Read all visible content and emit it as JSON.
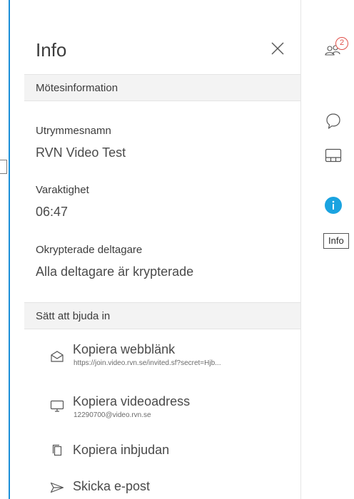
{
  "panel": {
    "title": "Info",
    "close_icon": "close-icon"
  },
  "meeting_info": {
    "section_title": "Mötesinformation",
    "fields": [
      {
        "label": "Utrymmesnamn",
        "value": "RVN Video Test"
      },
      {
        "label": "Varaktighet",
        "value": "06:47"
      },
      {
        "label": "Okrypterade deltagare",
        "value": "Alla deltagare är krypterade"
      }
    ]
  },
  "invite": {
    "section_title": "Sätt att bjuda in",
    "items": [
      {
        "icon": "envelope-open-icon",
        "title": "Kopiera webblänk",
        "subtitle": "https://join.video.rvn.se/invited.sf?secret=Hjb..."
      },
      {
        "icon": "monitor-icon",
        "title": "Kopiera videoadress",
        "subtitle": "12290700@video.rvn.se"
      },
      {
        "icon": "copy-icon",
        "title": "Kopiera inbjudan",
        "subtitle": ""
      },
      {
        "icon": "send-icon",
        "title": "Skicka e-post",
        "subtitle": ""
      }
    ]
  },
  "rail": {
    "participants_icon": "participants-icon",
    "participants_count": "2",
    "chat_icon": "chat-icon",
    "layout_icon": "layout-icon",
    "info_icon": "info-icon",
    "info_tooltip": "Info"
  },
  "colors": {
    "accent": "#1a8fd8",
    "info_active": "#1aa3e0",
    "badge": "#e0504a",
    "section_bg": "#f3f3f3"
  }
}
